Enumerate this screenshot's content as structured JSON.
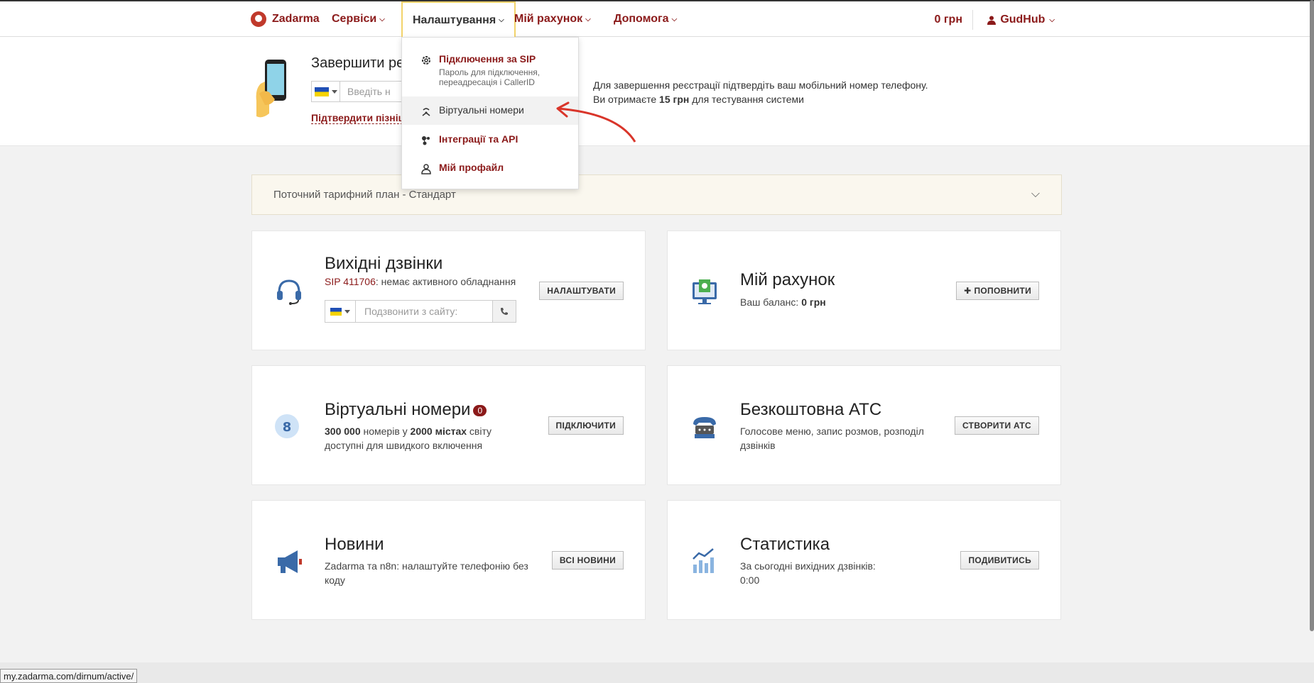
{
  "brand": {
    "name": "Zadarma"
  },
  "nav": [
    {
      "label": "Сервіси"
    },
    {
      "label": "Налаштування"
    },
    {
      "label": "Мій рахунок"
    },
    {
      "label": "Допомога"
    }
  ],
  "header": {
    "balance": "0 грн",
    "user": "GudHub"
  },
  "banner": {
    "title": "Завершити ре",
    "phone_placeholder": "Введіть н",
    "confirm_later": "Підтвердити пізніш",
    "info_line1": "Для завершення реєстрації підтвердіть ваш мобільний номер телефону.",
    "info_line2_pre": "Ви отримаєте ",
    "info_line2_bold": "15 грн",
    "info_line2_post": " для тестування системи"
  },
  "dropdown": {
    "items": [
      {
        "label": "Підключення за SIP",
        "sub": "Пароль для підключення, переадресація і CallerID",
        "icon": "gear-icon"
      },
      {
        "label": "Віртуальні номери",
        "icon": "antenna-icon"
      },
      {
        "label": "Інтеграції та API",
        "icon": "integration-icon"
      },
      {
        "label": "Мій профайл",
        "icon": "person-icon"
      }
    ]
  },
  "tariff": {
    "label": "Поточний тарифний план - Стандарт"
  },
  "cards": {
    "outgoing": {
      "title": "Вихідні дзвінки",
      "sip": "SIP 411706",
      "status": ": немає активного обладнання",
      "call_placeholder": "Подзвонити з сайту:",
      "button": "НАЛАШТУВАТИ"
    },
    "account": {
      "title": "Мій рахунок",
      "balance_label": "Ваш баланс: ",
      "balance_value": "0 грн",
      "button": "ПОПОВНИТИ"
    },
    "virtual": {
      "title": "Віртуальні номери",
      "badge": "0",
      "icon_digit": "8",
      "d1_b": "300 000",
      "d1_t": " номерів у ",
      "d2_b": "2000 містах",
      "d3": " світу",
      "line2": "доступні для швидкого включення",
      "button": "ПІДКЛЮЧИТИ"
    },
    "pbx": {
      "title": "Безкоштовна АТС",
      "desc": "Голосове меню, запис розмов, розподіл дзвінків",
      "button": "СТВОРИТИ АТС"
    },
    "news": {
      "title": "Новини",
      "desc": "Zadarma та n8n: налаштуйте телефонію без коду",
      "button": "ВСІ НОВИНИ"
    },
    "stats": {
      "title": "Статистика",
      "line1": "За сьогодні вихідних дзвінків:",
      "line2": "0:00",
      "button": "ПОДИВИТИСЬ"
    }
  },
  "statusbar": {
    "url": "my.zadarma.com/dirnum/active/"
  },
  "colors": {
    "brand": "#8b1a1a",
    "accent_border": "#f2d36b"
  }
}
